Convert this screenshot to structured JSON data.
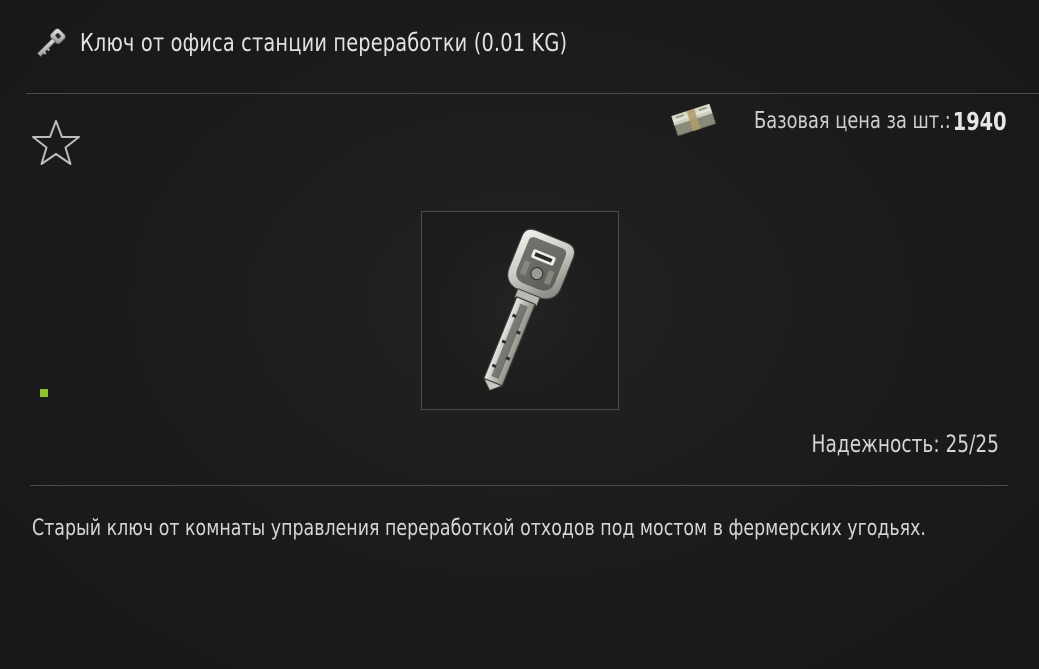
{
  "item": {
    "title": "Ключ от офиса станции переработки (0.01 KG)",
    "title_icon": "key-icon",
    "image_icon": "key-item-image",
    "price_label": "Базовая цена за шт.: ",
    "price_value": "1940",
    "price_icon": "money-stack-icon",
    "favorite_icon": "star-outline-icon",
    "durability": "Надежность: 25/25",
    "description": "Старый ключ от комнаты управления переработкой отходов под мостом в фермерских угодьях."
  },
  "colors": {
    "background": "#1a1a1a",
    "divider": "#4a4a4a",
    "text": "#d9d9d9",
    "status_dot": "#8ec12f"
  }
}
